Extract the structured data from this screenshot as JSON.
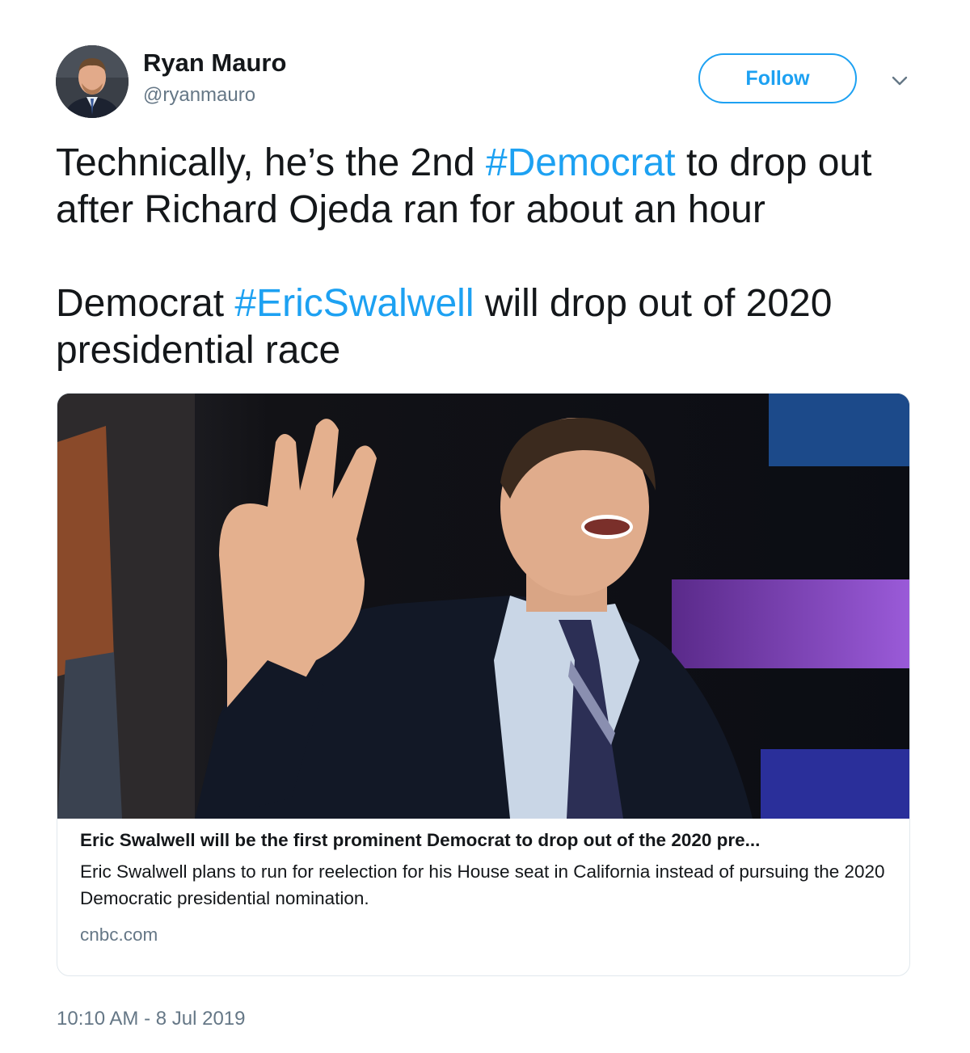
{
  "user": {
    "name": "Ryan Mauro",
    "handle": "@ryanmauro",
    "follow_label": "Follow"
  },
  "tweet": {
    "line1_pre": "Technically, he’s the 2nd ",
    "line1_hashtag": "#Democrat",
    "line1_post": " to drop out after Richard Ojeda ran for about an hour",
    "line2_pre": "Democrat ",
    "line2_hashtag": "#EricSwalwell",
    "line2_post": " will drop out of 2020 presidential race",
    "timestamp": "10:10 AM - 8 Jul 2019"
  },
  "card": {
    "title": "Eric Swalwell will be the first prominent Democrat to drop out of the 2020 pre...",
    "description": "Eric Swalwell plans to run for reelection for his House seat in California instead of pursuing the 2020 Democratic presidential nomination.",
    "domain": "cnbc.com"
  },
  "colors": {
    "accent": "#1da1f2",
    "text": "#14171a",
    "muted": "#657786",
    "border": "#e1e8ed"
  },
  "icons": {
    "menu": "chevron-down-icon"
  }
}
